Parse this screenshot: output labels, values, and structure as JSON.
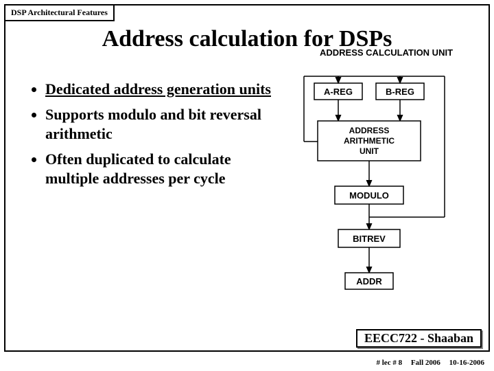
{
  "header": {
    "tag": "DSP Architectural Features"
  },
  "title": "Address calculation for DSPs",
  "bullets": {
    "b1": "Dedicated address generation units",
    "b2": "Supports modulo and bit reversal  arithmetic",
    "b3": "Often duplicated to calculate multiple addresses per cycle"
  },
  "diagram": {
    "caption": "ADDRESS CALCULATION UNIT",
    "areg": "A-REG",
    "breg": "B-REG",
    "aau1": "ADDRESS",
    "aau2": "ARITHMETIC",
    "aau3": "UNIT",
    "modulo": "MODULO",
    "bitrev": "BITREV",
    "addr": "ADDR"
  },
  "footer": {
    "course": "EECC722 - Shaaban",
    "page": "#  lec # 8",
    "term": "Fall 2006",
    "date": "10-16-2006"
  }
}
